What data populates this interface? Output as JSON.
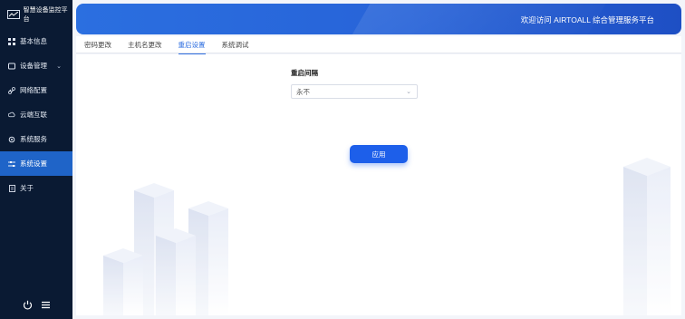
{
  "sidebar": {
    "brand": "智慧设备监控平台",
    "items": [
      {
        "label": "基本信息",
        "icon": "grid-icon",
        "active": false
      },
      {
        "label": "设备管理",
        "icon": "gear-icon",
        "active": false,
        "has_chevron": true
      },
      {
        "label": "网络配置",
        "icon": "link-icon",
        "active": false
      },
      {
        "label": "云端互联",
        "icon": "cloud-icon",
        "active": false
      },
      {
        "label": "系统服务",
        "icon": "settings-icon",
        "active": false
      },
      {
        "label": "系统设置",
        "icon": "sliders-icon",
        "active": true
      },
      {
        "label": "关于",
        "icon": "document-icon",
        "active": false
      }
    ],
    "footer_icons": [
      "power-icon",
      "menu-icon"
    ]
  },
  "header": {
    "welcome": "欢迎访问 AIRTOALL 综合管理服务平台"
  },
  "tabs": [
    {
      "label": "密码更改",
      "active": false
    },
    {
      "label": "主机名更改",
      "active": false
    },
    {
      "label": "重启设置",
      "active": true
    },
    {
      "label": "系统调试",
      "active": false
    }
  ],
  "form": {
    "restart_interval_label": "重启间隔",
    "restart_interval_value": "永不",
    "apply_label": "应用"
  },
  "colors": {
    "sidebar_bg": "#0a1a33",
    "sidebar_active": "#1f64c8",
    "header_blue": "#2763d8",
    "accent": "#1d5fea"
  }
}
